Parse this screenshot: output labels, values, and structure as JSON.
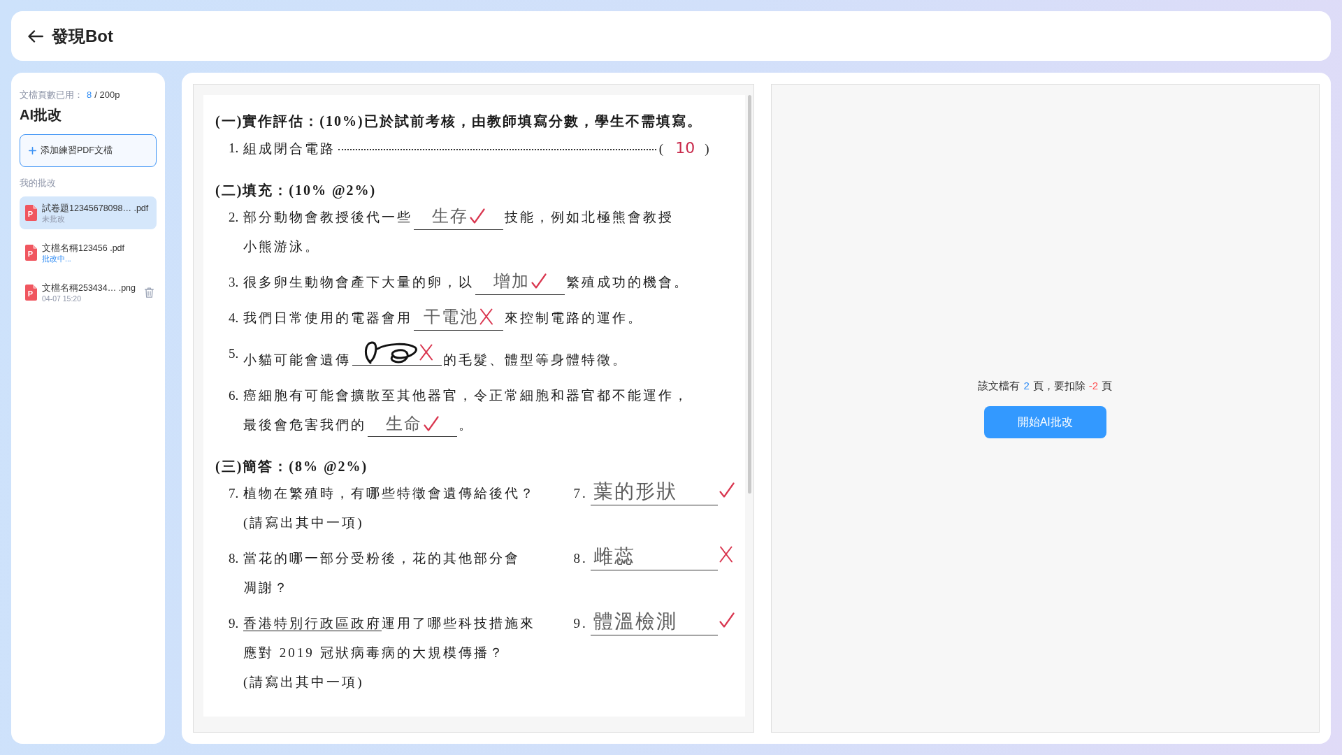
{
  "header": {
    "title": "發現Bot"
  },
  "sidebar": {
    "usage": {
      "label": "文檔頁數已用：",
      "used": "8",
      "total": "/ 200p"
    },
    "title": "AI批改",
    "add_button": "添加練習PDF文檔",
    "section_label": "我的批改",
    "files": [
      {
        "name": "試卷題12345678098… .pdf",
        "icon_letter": "P",
        "status": {
          "text": "未批改",
          "kind": "idle"
        },
        "selected": true,
        "hovered": false
      },
      {
        "name": "文檔名稱123456 .pdf",
        "icon_letter": "P",
        "status": {
          "text": "批改中...",
          "kind": "progress"
        },
        "selected": false,
        "hovered": false
      },
      {
        "name": "文檔名稱253434… .png",
        "icon_letter": "P",
        "status": {
          "text": "04-07 15:20",
          "kind": "date"
        },
        "selected": false,
        "hovered": true
      }
    ]
  },
  "document": {
    "sections": [
      {
        "heading": "(一)實作評估：(10%)已於試前考核，由教師填寫分數，學生不需填寫。",
        "questions": [
          {
            "kind": "score",
            "number": "1.",
            "text": "組成閉合電路",
            "score_open": "(",
            "score": "10",
            "score_close": ")"
          }
        ]
      },
      {
        "heading": "(二)填充：(10% @2%)",
        "questions": [
          {
            "kind": "fill",
            "number": "2.",
            "lines": [
              {
                "before": "部分動物會教授後代一些",
                "blank": {
                  "answer": "生存",
                  "scribbled": false,
                  "correct": true
                },
                "after": "技能，例如北極熊會教授"
              },
              {
                "before": "小熊游泳。"
              }
            ]
          },
          {
            "kind": "fill",
            "number": "3.",
            "lines": [
              {
                "before": "很多卵生動物會產下大量的卵，以",
                "blank": {
                  "answer": "增加",
                  "scribbled": false,
                  "correct": true
                },
                "after": "繁殖成功的機會。"
              }
            ]
          },
          {
            "kind": "fill",
            "number": "4.",
            "lines": [
              {
                "before": "我們日常使用的電器會用",
                "blank": {
                  "answer": "干電池",
                  "scribbled": false,
                  "correct": false
                },
                "after": "來控制電路的運作。"
              }
            ]
          },
          {
            "kind": "fill",
            "number": "5.",
            "lines": [
              {
                "before": "小貓可能會遺傳",
                "blank": {
                  "scribbled": true,
                  "correct": false
                },
                "after": "的毛髮、體型等身體特徵。"
              }
            ]
          },
          {
            "kind": "fill",
            "number": "6.",
            "lines": [
              {
                "before": "癌細胞有可能會擴散至其他器官，令正常細胞和器官都不能運作，"
              },
              {
                "before": "最後會危害我們的",
                "blank": {
                  "answer": "生命",
                  "scribbled": false,
                  "correct": true
                },
                "after": "。"
              }
            ]
          }
        ]
      },
      {
        "heading": "(三)簡答：(8% @2%)",
        "questions": [
          {
            "kind": "short",
            "number": "7.",
            "lines": [
              [
                {
                  "text": "植物在繁殖時，有哪些特徵會遺傳給後代？",
                  "underlined": false
                }
              ],
              [
                {
                  "text": "(請寫出其中一項)",
                  "underlined": false
                }
              ]
            ],
            "answer_number": "7.",
            "answer": "葉的形狀",
            "correct": true
          },
          {
            "kind": "short",
            "number": "8.",
            "lines": [
              [
                {
                  "text": "當花的哪一部分受粉後，花的其他部分會",
                  "underlined": false
                }
              ],
              [
                {
                  "text": "凋謝？",
                  "underlined": false
                }
              ]
            ],
            "answer_number": "8.",
            "answer": "雌蕊",
            "correct": false
          },
          {
            "kind": "short",
            "number": "9.",
            "lines": [
              [
                {
                  "text": "香港特別行政區政府",
                  "underlined": true
                },
                {
                  "text": "運用了哪些科技措施來",
                  "underlined": false
                }
              ],
              [
                {
                  "text": "應對 2019 冠狀病毒病的大規模傳播？",
                  "underlined": false
                }
              ],
              [
                {
                  "text": "(請寫出其中一項)",
                  "underlined": false
                }
              ]
            ],
            "answer_number": "9.",
            "answer": "體溫檢測",
            "correct": true
          }
        ]
      }
    ]
  },
  "result_panel": {
    "notice": {
      "text_before": "該文檔有",
      "page_count": "2",
      "text_middle": "頁，要扣除",
      "deduct_count": "-2",
      "text_after": "頁"
    },
    "button": "開始AI批改"
  }
}
